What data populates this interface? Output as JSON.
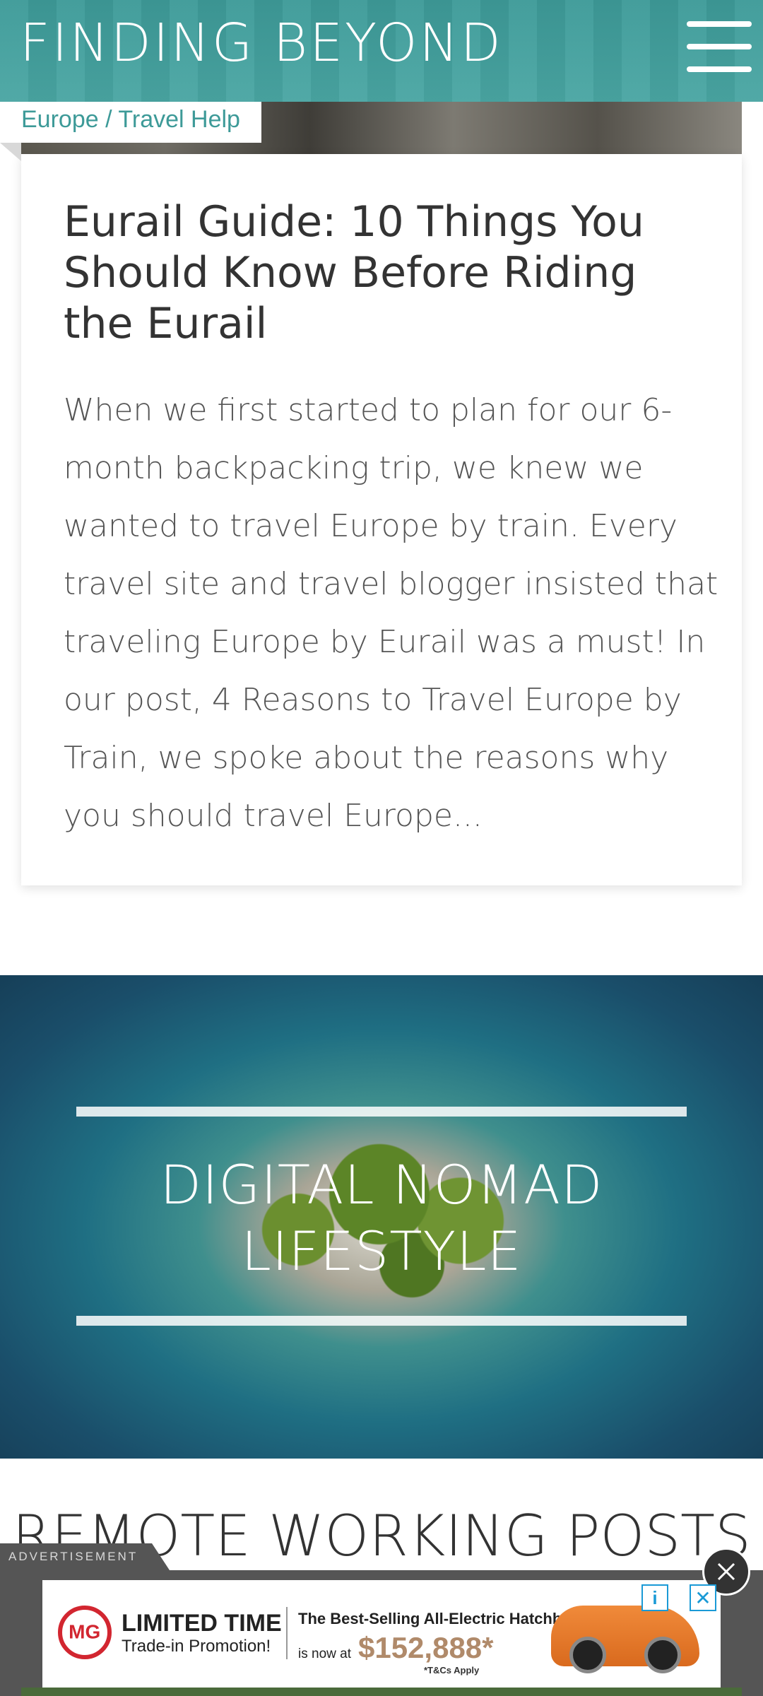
{
  "header": {
    "site_title": "FINDING BEYOND",
    "menu_icon": "hamburger-menu-icon"
  },
  "post": {
    "category": "Europe / Travel Help",
    "title": "Eurail Guide: 10 Things You Should Know Before Riding the Eurail",
    "excerpt": "When we first started to plan for our 6-month backpacking trip, we knew we wanted to travel Europe by train.  Every travel site and travel blogger insisted that traveling Europe by Eurail was a must!  In our post, 4 Reasons to Travel Europe by Train, we spoke about the reasons why you should travel Europe..."
  },
  "banner": {
    "title": "DIGITAL NOMAD LIFESTYLE"
  },
  "section": {
    "heading": "REMOTE WORKING POSTS"
  },
  "ad": {
    "label": "ADVERTISEMENT",
    "close_icon": "close-icon",
    "brand_mark": "MG",
    "headline": "LIMITED TIME",
    "subhead": "Trade-in Promotion!",
    "copy": "The Best-Selling All-Electric Hatchback",
    "price_prefix": "is now at",
    "price": "$152,888*",
    "terms": "*T&Cs Apply",
    "info_icon": "info-icon",
    "info_glyph": "i",
    "dismiss_glyph": "✕"
  },
  "colors": {
    "brand_teal": "#3d9a98",
    "ad_bar": "#555555",
    "ad_price": "#b08a6a",
    "ad_brand_red": "#d22630"
  }
}
